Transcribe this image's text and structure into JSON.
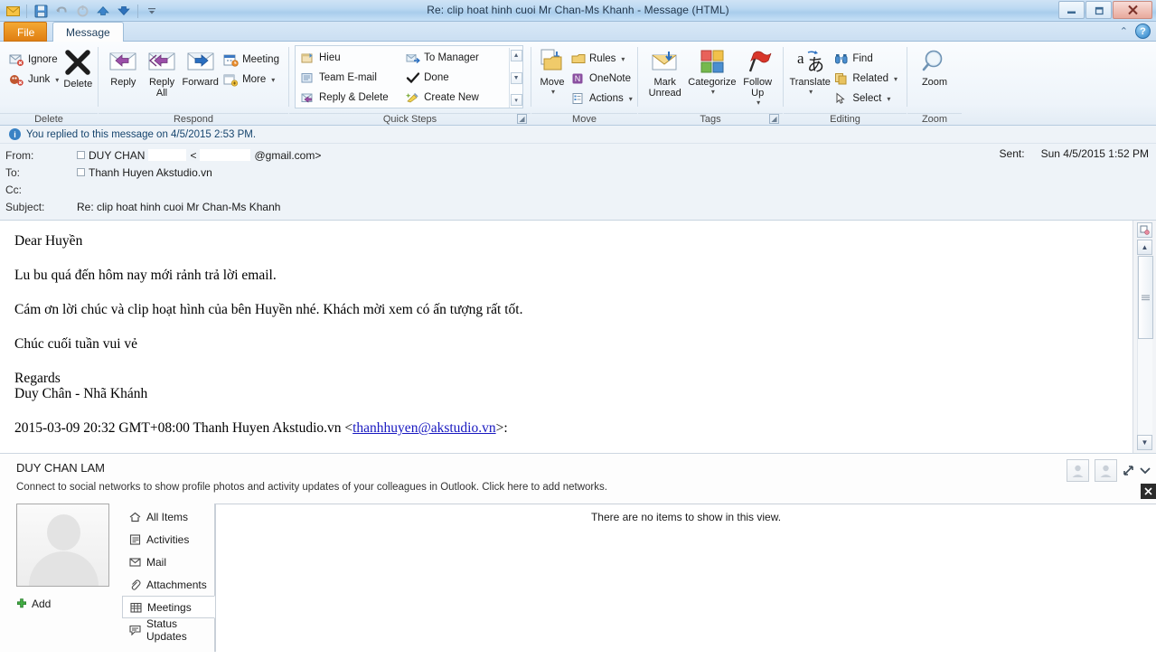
{
  "window": {
    "title": "Re: clip hoat hinh cuoi Mr Chan-Ms Khanh  -  Message (HTML)",
    "minimize": "–",
    "restore": "❐",
    "close": "✕",
    "help": "?",
    "collapse_ribbon": "⌃"
  },
  "quick_access": {
    "mail_icon": "envelope-icon",
    "save_icon": "save-icon",
    "undo_icon": "undo-icon",
    "redo_icon": "redo-icon",
    "previous_icon": "previous-item-icon",
    "next_icon": "next-item-icon",
    "customize_icon": "customize-toolbar-icon"
  },
  "tabs": [
    {
      "id": "file",
      "label": "File"
    },
    {
      "id": "message",
      "label": "Message"
    }
  ],
  "ribbon": {
    "groups": [
      {
        "id": "delete",
        "label": "Delete",
        "items": [
          {
            "label": "Ignore",
            "icon": "ignore-icon"
          },
          {
            "label": "Junk",
            "icon": "junk-icon",
            "caret": "▾"
          },
          {
            "label": "Delete",
            "icon": "delete-x-icon"
          }
        ]
      },
      {
        "id": "respond",
        "label": "Respond",
        "items": [
          {
            "label": "Reply",
            "icon": "reply-icon"
          },
          {
            "label": "Reply\nAll",
            "icon": "reply-all-icon"
          },
          {
            "label": "Forward",
            "icon": "forward-icon"
          },
          {
            "label": "Meeting",
            "icon": "meeting-icon"
          },
          {
            "label": "More",
            "icon": "more-icon",
            "caret": "▾"
          }
        ]
      },
      {
        "id": "quick-steps",
        "label": "Quick Steps",
        "items": [
          {
            "label": "Hieu",
            "icon": "quick-step-hieu-icon"
          },
          {
            "label": "Team E-mail",
            "icon": "team-email-icon"
          },
          {
            "label": "Reply & Delete",
            "icon": "reply-delete-icon"
          },
          {
            "label": "To Manager",
            "icon": "to-manager-icon"
          },
          {
            "label": "Done",
            "icon": "done-check-icon"
          },
          {
            "label": "Create New",
            "icon": "create-new-icon"
          }
        ]
      },
      {
        "id": "move",
        "label": "Move",
        "items": [
          {
            "label": "Move",
            "icon": "move-icon",
            "caret": "▾"
          },
          {
            "label": "Rules",
            "icon": "rules-icon",
            "caret": "▾"
          },
          {
            "label": "OneNote",
            "icon": "onenote-icon"
          },
          {
            "label": "Actions",
            "icon": "actions-icon",
            "caret": "▾"
          }
        ]
      },
      {
        "id": "tags",
        "label": "Tags",
        "items": [
          {
            "label": "Mark\nUnread",
            "icon": "mark-unread-icon"
          },
          {
            "label": "Categorize",
            "icon": "categorize-icon",
            "caret": "▾"
          },
          {
            "label": "Follow\nUp",
            "icon": "follow-up-flag-icon",
            "caret": "▾"
          }
        ]
      },
      {
        "id": "editing",
        "label": "Editing",
        "items": [
          {
            "label": "Translate",
            "icon": "translate-icon",
            "caret": "▾"
          },
          {
            "label": "Find",
            "icon": "find-binoculars-icon"
          },
          {
            "label": "Related",
            "icon": "related-icon",
            "caret": "▾"
          },
          {
            "label": "Select",
            "icon": "select-pointer-icon",
            "caret": "▾"
          }
        ]
      },
      {
        "id": "zoom",
        "label": "Zoom",
        "items": [
          {
            "label": "Zoom",
            "icon": "zoom-magnifier-icon"
          }
        ]
      }
    ]
  },
  "notice": {
    "icon": "info-icon",
    "text": "You replied to this message on 4/5/2015 2:53 PM."
  },
  "header": {
    "from_label": "From:",
    "from_value_1": "DUY CHAN",
    "from_bracket_open": "<",
    "from_domain": "@gmail.com>",
    "to_label": "To:",
    "to_value": "Thanh Huyen Akstudio.vn",
    "cc_label": "Cc:",
    "cc_value": "",
    "subject_label": "Subject:",
    "subject_value": "Re: clip hoat hinh cuoi Mr Chan-Ms Khanh",
    "sent_label": "Sent:",
    "sent_value": "Sun 4/5/2015 1:52 PM"
  },
  "body": {
    "greeting": "Dear Huyền",
    "para1": "Lu bu quá đến hôm nay mới rảnh trả lời email.",
    "para2": "Cám ơn lời chúc và clip hoạt hình của bên Huyền nhé. Khách mời xem có ấn tượng rất tốt.",
    "para3": "Chúc cuối tuần vui vẻ",
    "sign_off": "Regards",
    "signature": "Duy Chân - Nhã Khánh",
    "quote_prefix": "2015-03-09 20:32 GMT+08:00 Thanh Huyen Akstudio.vn <",
    "quote_link": "thanhhuyen@akstudio.vn",
    "quote_suffix": ">:"
  },
  "people_pane": {
    "contact_name": "DUY CHAN LAM",
    "connect_note": "Connect to social networks to show profile photos and activity updates of your colleagues in Outlook. Click here to add networks.",
    "add_label": "Add",
    "empty_message": "There are no items to show in this view.",
    "expand_icon": "expand-arrows-icon",
    "chevron_icon": "chevron-down-icon",
    "close_icon": "close-icon",
    "nav": [
      {
        "label": "All Items",
        "icon": "home-icon",
        "selected": false
      },
      {
        "label": "Activities",
        "icon": "activities-icon",
        "selected": false
      },
      {
        "label": "Mail",
        "icon": "mail-envelope-icon",
        "selected": false
      },
      {
        "label": "Attachments",
        "icon": "paperclip-icon",
        "selected": false
      },
      {
        "label": "Meetings",
        "icon": "calendar-grid-icon",
        "selected": true
      },
      {
        "label": "Status Updates",
        "icon": "status-updates-icon",
        "selected": false
      }
    ]
  },
  "colors": {
    "file_tab": "#e07f12",
    "link": "#1818c0",
    "title_bar": "#bcd9f2",
    "accent_blue": "#3a82c4"
  }
}
